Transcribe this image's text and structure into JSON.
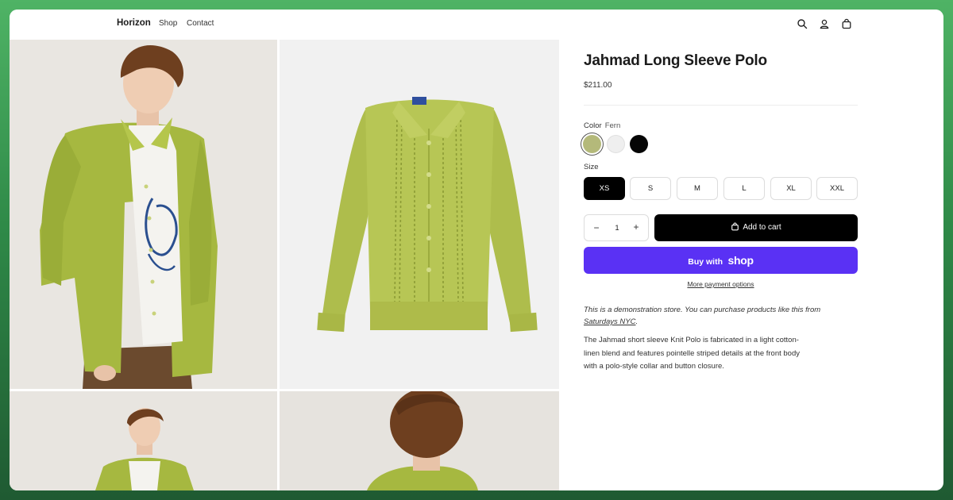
{
  "header": {
    "brand": "Horizon",
    "nav": [
      "Shop",
      "Contact"
    ],
    "icons": [
      "search-icon",
      "account-icon",
      "cart-icon"
    ]
  },
  "product": {
    "title": "Jahmad Long Sleeve Polo",
    "price": "$211.00",
    "color_label": "Color",
    "color_selected": "Fern",
    "colors": [
      {
        "name": "Fern",
        "hex": "#b4b97a"
      },
      {
        "name": "White",
        "hex": "#efefef"
      },
      {
        "name": "Black",
        "hex": "#050505"
      }
    ],
    "size_label": "Size",
    "sizes": [
      "XS",
      "S",
      "M",
      "L",
      "XL",
      "XXL"
    ],
    "size_selected": "XS",
    "quantity": "1",
    "quantity_minus": "−",
    "quantity_plus": "+",
    "add_to_cart": "Add to cart",
    "buy_with": "Buy with",
    "buy_brand": "shop",
    "more_payment": "More payment options",
    "demo_text": "This is a demonstration store. You can purchase products like this from",
    "demo_link": "Saturdays NYC",
    "demo_suffix": ".",
    "description": "The Jahmad short sleeve Knit Polo is fabricated in a light cotton-linen blend and features pointelle striped details at the front body with a polo-style collar and button closure."
  },
  "colors": {
    "accent_shop": "#5a31f4",
    "primary_button": "#000000",
    "background_gradient": "#3b9a53"
  }
}
